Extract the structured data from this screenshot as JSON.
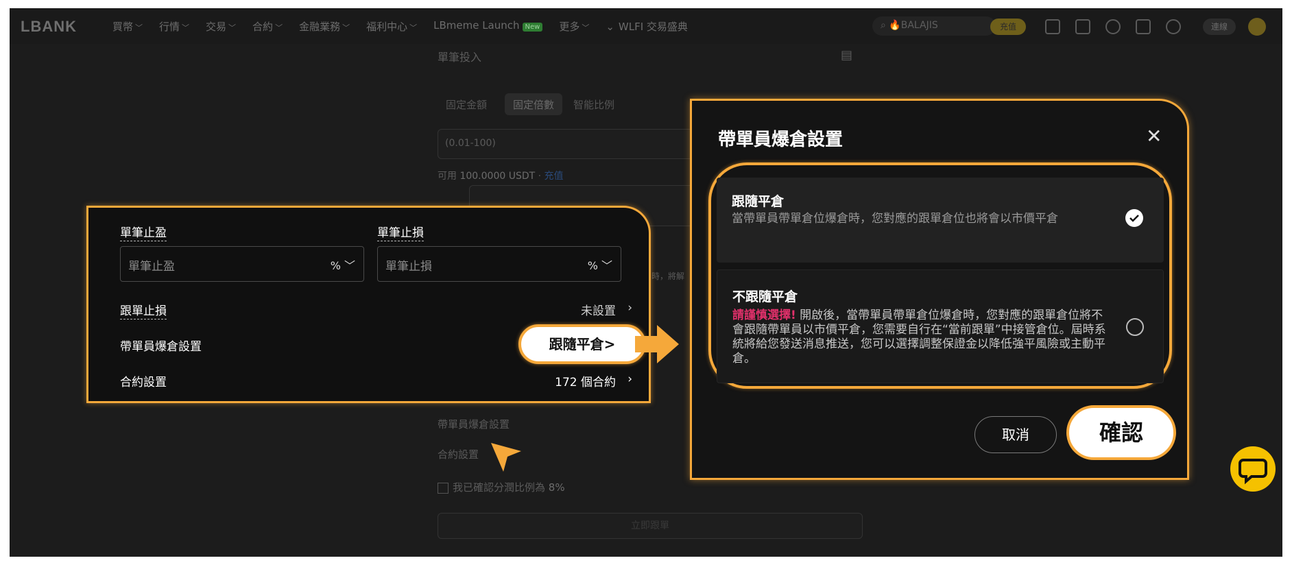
{
  "nav": {
    "logo": "LBANK",
    "links": [
      "買幣",
      "行情",
      "交易",
      "合約",
      "金融業務",
      "福利中心"
    ],
    "launch": "LBmeme Launch",
    "new_badge": "New",
    "more": "更多",
    "wlfi": "WLFI 交易盛典",
    "search_placeholder": "🔥BALAJIS",
    "charge": "充值",
    "connect": "連線",
    "icons": [
      "wallet-icon",
      "orders-icon",
      "bell-icon",
      "download-icon",
      "globe-icon"
    ]
  },
  "background_form": {
    "section": "單筆投入",
    "tabs": [
      "固定金額",
      "固定倍數",
      "智能比例"
    ],
    "active_tab": "固定倍數",
    "range_placeholder": "(0.01-100)",
    "available_prefix": "可用",
    "available_value": "100.0000 USDT",
    "topup": "充值",
    "partial_notice": "時，將解",
    "liq_label": "帶單員爆倉設置",
    "contract_label": "合約設置",
    "confirm_share": "我已確認分潤比例為",
    "share_value": "8%",
    "submit": "立即跟單"
  },
  "left_panel": {
    "tp_label": "單筆止盈",
    "tp_placeholder": "單筆止盈",
    "sl_label": "單筆止損",
    "sl_placeholder": "單筆止損",
    "unit": "%",
    "trail_sl_label": "跟單止損",
    "trail_sl_value": "未設置",
    "liq_label": "帶單員爆倉設置",
    "contract_label": "合約設置",
    "contract_value": "172 個合約"
  },
  "callout": "跟隨平倉>",
  "modal": {
    "title": "帶單員爆倉設置",
    "options": [
      {
        "title": "跟隨平倉",
        "desc": "當帶單員帶單倉位爆倉時，您對應的跟單倉位也將會以市價平倉",
        "selected": true
      },
      {
        "title": "不跟隨平倉",
        "warning": "請謹慎選擇!",
        "desc": "開啟後，當帶單員帶單倉位爆倉時，您對應的跟單倉位將不會跟隨帶單員以市價平倉，您需要自行在“當前跟單”中接管倉位。屆時系統將給您發送消息推送，您可以選擇調整保證金以降低強平風險或主動平倉。",
        "selected": false
      }
    ],
    "cancel": "取消",
    "confirm": "確認"
  },
  "colors": {
    "highlight": "#f5a83a",
    "warning": "#e0306a",
    "chat": "#f5c100"
  }
}
